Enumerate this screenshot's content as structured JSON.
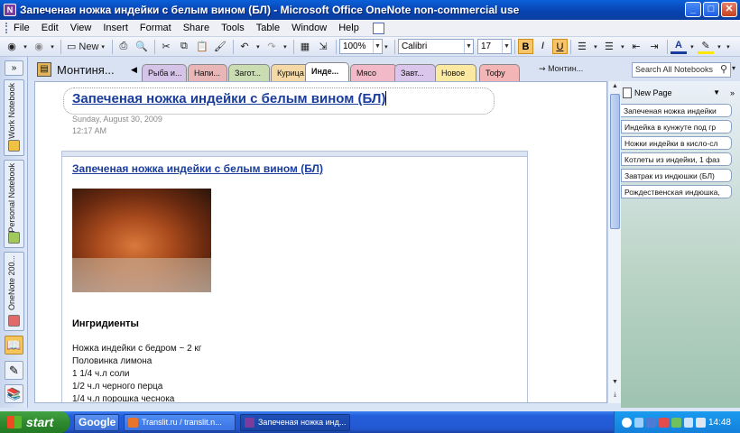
{
  "window": {
    "title": "Запеченая ножка индейки с белым вином (БЛ) - Microsoft Office OneNote non-commercial use",
    "app_icon": "onenote-icon",
    "buttons": [
      "minimize",
      "maximize",
      "close"
    ]
  },
  "menu": {
    "items": [
      "File",
      "Edit",
      "View",
      "Insert",
      "Format",
      "Share",
      "Tools",
      "Table",
      "Window",
      "Help"
    ]
  },
  "toolbar": {
    "new_label": "New",
    "zoom": "100%",
    "font": "Calibri",
    "font_size": "17",
    "bold": "B",
    "italic": "I",
    "underline": "U"
  },
  "notebooks": [
    {
      "label": "Work Notebook",
      "color": "#f0c243"
    },
    {
      "label": "Personal Notebook",
      "color": "#9fc95a"
    },
    {
      "label": "OneNote 200...",
      "color": "#e06a6a"
    }
  ],
  "notebook": {
    "title": "Монтиня..."
  },
  "sections": [
    {
      "label": "Рыба и...",
      "color": "#d6c3e8"
    },
    {
      "label": "Напи...",
      "color": "#e8b6b6"
    },
    {
      "label": "Загот...",
      "color": "#c9dcb2"
    },
    {
      "label": "Курица",
      "color": "#f4d9a6"
    },
    {
      "label": "Инде...",
      "color": "#ffffff",
      "active": true
    },
    {
      "label": "Мясо",
      "color": "#f2b9c9"
    },
    {
      "label": "Завт...",
      "color": "#d9c6ea"
    },
    {
      "label": "Новое",
      "color": "#fbe9a1"
    },
    {
      "label": "Тофу",
      "color": "#f3b5b5"
    }
  ],
  "section_link": "Монтин...",
  "search": {
    "placeholder": "Search All Notebooks"
  },
  "page": {
    "title": "Запеченая ножка индейки с белым вином (БЛ)",
    "date": "Sunday, August 30, 2009",
    "time": "12:17 AM",
    "recipe_title": "Запеченая ножка индейки с белым вином (БЛ)",
    "ingredients_heading": "Ингридиенты",
    "ingredients": [
      "Ножка индейки с бедром ~ 2 кг",
      "Половинка лимона",
      "1 1/4 ч.л соли",
      "1/2 ч.л черного перца",
      "1/4 ч.л порошка чеснока"
    ]
  },
  "pages_panel": {
    "new_page": "New Page",
    "pages": [
      "Запеченая ножка индейки",
      "Индейка в кунжуте под гр",
      "Ножки индейки в кисло-сл",
      "Котлеты из индейки, 1 фаз",
      "Завтрак из индюшки (БЛ)",
      "Рождественская индюшка,"
    ]
  },
  "taskbar": {
    "start": "start",
    "google": "Google",
    "tasks": [
      "Translit.ru / translit.n...",
      "Запеченая ножка инд..."
    ],
    "clock": "14:48"
  }
}
